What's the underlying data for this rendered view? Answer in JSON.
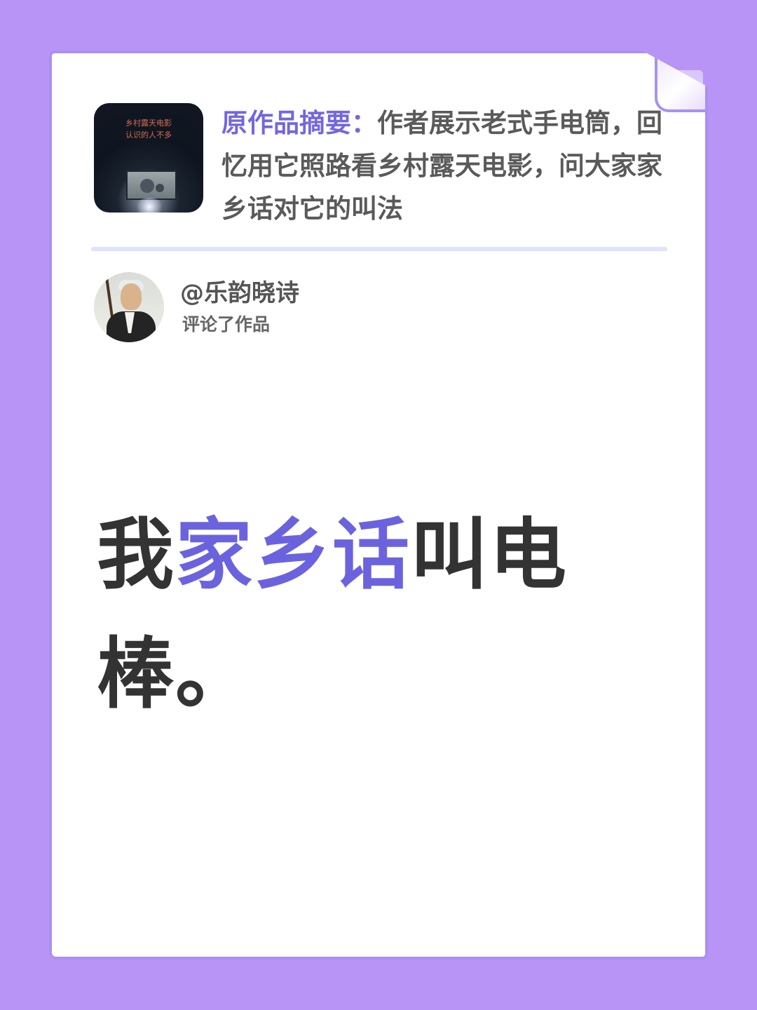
{
  "colors": {
    "background": "#b794f6",
    "accent": "#6b63de",
    "text": "#333333"
  },
  "summary": {
    "label": "原作品摘要：",
    "text": "作者展示老式手电筒，回忆用它照路看乡村露天电影，问大家家乡话对它的叫法",
    "thumbnail_title_line1": "乡村露天电影",
    "thumbnail_title_line2": "认识的人不多"
  },
  "user": {
    "name": "@乐韵晓诗",
    "action": "评论了作品",
    "avatar_icon": "person-with-erhu-avatar"
  },
  "comment": {
    "before": "我",
    "highlight": "家乡话",
    "after": "叫电棒。"
  }
}
